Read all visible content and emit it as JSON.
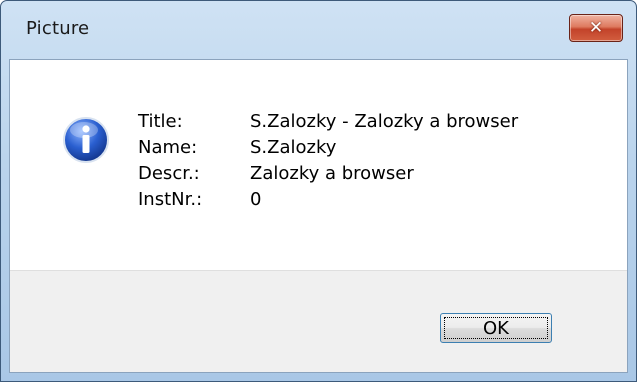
{
  "window": {
    "title": "Picture",
    "close_label": "✕"
  },
  "icon": "info-icon",
  "details": [
    {
      "label": "Title:",
      "value": "S.Zalozky - Zalozky a browser"
    },
    {
      "label": "Name:",
      "value": "S.Zalozky"
    },
    {
      "label": "Descr.:",
      "value": "Zalozky a browser"
    },
    {
      "label": "InstNr.:",
      "value": "0"
    }
  ],
  "buttons": {
    "ok_label": "OK"
  },
  "colors": {
    "close_button": "#c3432a",
    "title_bar": "#b9d3ec",
    "icon_blue": "#1f4fb8"
  }
}
